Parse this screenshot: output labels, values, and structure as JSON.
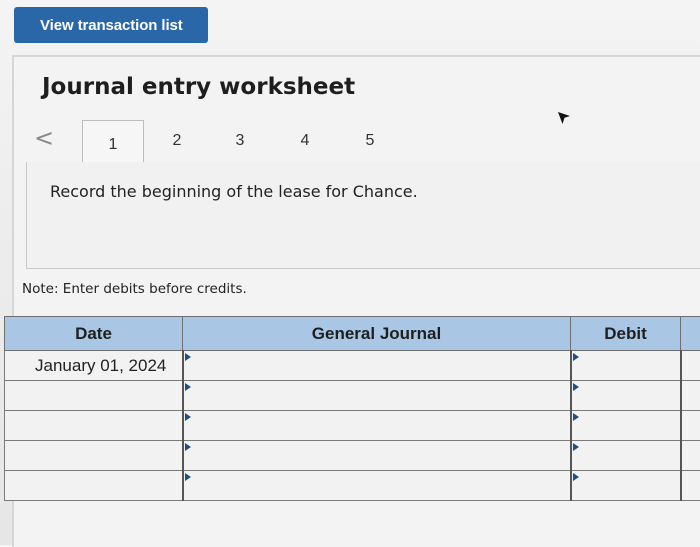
{
  "toolbar": {
    "view_button_label": "View transaction list"
  },
  "header": {
    "title": "Journal entry worksheet"
  },
  "tabs": {
    "prev_label": "<",
    "items": [
      "1",
      "2",
      "3",
      "4",
      "5"
    ],
    "active_index": 0
  },
  "instruction": "Record the beginning of the lease for Chance.",
  "note": "Note: Enter debits before credits.",
  "journal": {
    "columns": [
      "Date",
      "General Journal",
      "Debit"
    ],
    "rows": [
      {
        "date": "January 01, 2024",
        "account": "",
        "debit": ""
      },
      {
        "date": "",
        "account": "",
        "debit": ""
      },
      {
        "date": "",
        "account": "",
        "debit": ""
      },
      {
        "date": "",
        "account": "",
        "debit": ""
      },
      {
        "date": "",
        "account": "",
        "debit": ""
      }
    ]
  },
  "colors": {
    "button_blue": "#2a67a8",
    "header_blue": "#a9c6e4",
    "marker_blue": "#1d4f86"
  }
}
